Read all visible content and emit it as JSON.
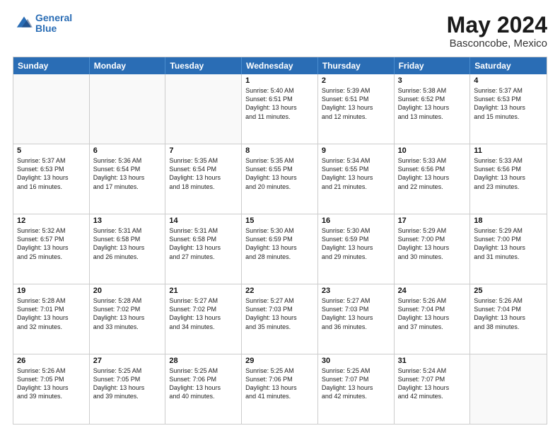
{
  "header": {
    "logo_line1": "General",
    "logo_line2": "Blue",
    "main_title": "May 2024",
    "subtitle": "Basconcobe, Mexico"
  },
  "days_of_week": [
    "Sunday",
    "Monday",
    "Tuesday",
    "Wednesday",
    "Thursday",
    "Friday",
    "Saturday"
  ],
  "rows": [
    {
      "cells": [
        {
          "day": "",
          "text": "",
          "empty": true
        },
        {
          "day": "",
          "text": "",
          "empty": true
        },
        {
          "day": "",
          "text": "",
          "empty": true
        },
        {
          "day": "1",
          "text": "Sunrise: 5:40 AM\nSunset: 6:51 PM\nDaylight: 13 hours\nand 11 minutes.",
          "empty": false
        },
        {
          "day": "2",
          "text": "Sunrise: 5:39 AM\nSunset: 6:51 PM\nDaylight: 13 hours\nand 12 minutes.",
          "empty": false
        },
        {
          "day": "3",
          "text": "Sunrise: 5:38 AM\nSunset: 6:52 PM\nDaylight: 13 hours\nand 13 minutes.",
          "empty": false
        },
        {
          "day": "4",
          "text": "Sunrise: 5:37 AM\nSunset: 6:53 PM\nDaylight: 13 hours\nand 15 minutes.",
          "empty": false
        }
      ]
    },
    {
      "cells": [
        {
          "day": "5",
          "text": "Sunrise: 5:37 AM\nSunset: 6:53 PM\nDaylight: 13 hours\nand 16 minutes.",
          "empty": false
        },
        {
          "day": "6",
          "text": "Sunrise: 5:36 AM\nSunset: 6:54 PM\nDaylight: 13 hours\nand 17 minutes.",
          "empty": false
        },
        {
          "day": "7",
          "text": "Sunrise: 5:35 AM\nSunset: 6:54 PM\nDaylight: 13 hours\nand 18 minutes.",
          "empty": false
        },
        {
          "day": "8",
          "text": "Sunrise: 5:35 AM\nSunset: 6:55 PM\nDaylight: 13 hours\nand 20 minutes.",
          "empty": false
        },
        {
          "day": "9",
          "text": "Sunrise: 5:34 AM\nSunset: 6:55 PM\nDaylight: 13 hours\nand 21 minutes.",
          "empty": false
        },
        {
          "day": "10",
          "text": "Sunrise: 5:33 AM\nSunset: 6:56 PM\nDaylight: 13 hours\nand 22 minutes.",
          "empty": false
        },
        {
          "day": "11",
          "text": "Sunrise: 5:33 AM\nSunset: 6:56 PM\nDaylight: 13 hours\nand 23 minutes.",
          "empty": false
        }
      ]
    },
    {
      "cells": [
        {
          "day": "12",
          "text": "Sunrise: 5:32 AM\nSunset: 6:57 PM\nDaylight: 13 hours\nand 25 minutes.",
          "empty": false
        },
        {
          "day": "13",
          "text": "Sunrise: 5:31 AM\nSunset: 6:58 PM\nDaylight: 13 hours\nand 26 minutes.",
          "empty": false
        },
        {
          "day": "14",
          "text": "Sunrise: 5:31 AM\nSunset: 6:58 PM\nDaylight: 13 hours\nand 27 minutes.",
          "empty": false
        },
        {
          "day": "15",
          "text": "Sunrise: 5:30 AM\nSunset: 6:59 PM\nDaylight: 13 hours\nand 28 minutes.",
          "empty": false
        },
        {
          "day": "16",
          "text": "Sunrise: 5:30 AM\nSunset: 6:59 PM\nDaylight: 13 hours\nand 29 minutes.",
          "empty": false
        },
        {
          "day": "17",
          "text": "Sunrise: 5:29 AM\nSunset: 7:00 PM\nDaylight: 13 hours\nand 30 minutes.",
          "empty": false
        },
        {
          "day": "18",
          "text": "Sunrise: 5:29 AM\nSunset: 7:00 PM\nDaylight: 13 hours\nand 31 minutes.",
          "empty": false
        }
      ]
    },
    {
      "cells": [
        {
          "day": "19",
          "text": "Sunrise: 5:28 AM\nSunset: 7:01 PM\nDaylight: 13 hours\nand 32 minutes.",
          "empty": false
        },
        {
          "day": "20",
          "text": "Sunrise: 5:28 AM\nSunset: 7:02 PM\nDaylight: 13 hours\nand 33 minutes.",
          "empty": false
        },
        {
          "day": "21",
          "text": "Sunrise: 5:27 AM\nSunset: 7:02 PM\nDaylight: 13 hours\nand 34 minutes.",
          "empty": false
        },
        {
          "day": "22",
          "text": "Sunrise: 5:27 AM\nSunset: 7:03 PM\nDaylight: 13 hours\nand 35 minutes.",
          "empty": false
        },
        {
          "day": "23",
          "text": "Sunrise: 5:27 AM\nSunset: 7:03 PM\nDaylight: 13 hours\nand 36 minutes.",
          "empty": false
        },
        {
          "day": "24",
          "text": "Sunrise: 5:26 AM\nSunset: 7:04 PM\nDaylight: 13 hours\nand 37 minutes.",
          "empty": false
        },
        {
          "day": "25",
          "text": "Sunrise: 5:26 AM\nSunset: 7:04 PM\nDaylight: 13 hours\nand 38 minutes.",
          "empty": false
        }
      ]
    },
    {
      "cells": [
        {
          "day": "26",
          "text": "Sunrise: 5:26 AM\nSunset: 7:05 PM\nDaylight: 13 hours\nand 39 minutes.",
          "empty": false
        },
        {
          "day": "27",
          "text": "Sunrise: 5:25 AM\nSunset: 7:05 PM\nDaylight: 13 hours\nand 39 minutes.",
          "empty": false
        },
        {
          "day": "28",
          "text": "Sunrise: 5:25 AM\nSunset: 7:06 PM\nDaylight: 13 hours\nand 40 minutes.",
          "empty": false
        },
        {
          "day": "29",
          "text": "Sunrise: 5:25 AM\nSunset: 7:06 PM\nDaylight: 13 hours\nand 41 minutes.",
          "empty": false
        },
        {
          "day": "30",
          "text": "Sunrise: 5:25 AM\nSunset: 7:07 PM\nDaylight: 13 hours\nand 42 minutes.",
          "empty": false
        },
        {
          "day": "31",
          "text": "Sunrise: 5:24 AM\nSunset: 7:07 PM\nDaylight: 13 hours\nand 42 minutes.",
          "empty": false
        },
        {
          "day": "",
          "text": "",
          "empty": true
        }
      ]
    }
  ]
}
